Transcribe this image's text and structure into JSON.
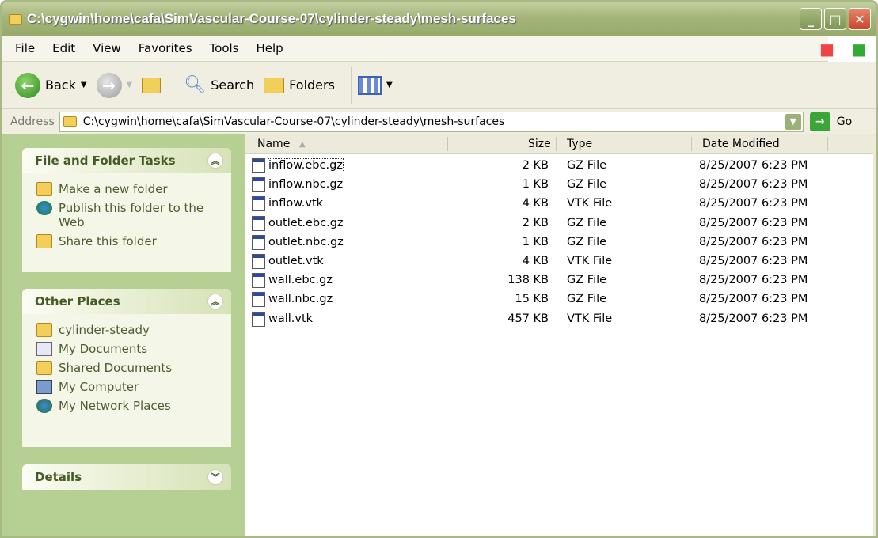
{
  "window": {
    "title": "C:\\cygwin\\home\\cafa\\SimVascular-Course-07\\cylinder-steady\\mesh-surfaces",
    "min": "_",
    "max": "□",
    "close": "✕"
  },
  "menu": [
    "File",
    "Edit",
    "View",
    "Favorites",
    "Tools",
    "Help"
  ],
  "toolbar": {
    "back": "Back",
    "search": "Search",
    "folders": "Folders"
  },
  "address": {
    "label": "Address",
    "value": "C:\\cygwin\\home\\cafa\\SimVascular-Course-07\\cylinder-steady\\mesh-surfaces",
    "go": "Go"
  },
  "sidebar": {
    "tasks": {
      "title": "File and Folder Tasks",
      "items": [
        "Make a new folder",
        "Publish this folder to the Web",
        "Share this folder"
      ]
    },
    "places": {
      "title": "Other Places",
      "items": [
        "cylinder-steady",
        "My Documents",
        "Shared Documents",
        "My Computer",
        "My Network Places"
      ]
    },
    "details": {
      "title": "Details"
    }
  },
  "columns": {
    "name": "Name",
    "size": "Size",
    "type": "Type",
    "date": "Date Modified"
  },
  "files": [
    {
      "name": "inflow.ebc.gz",
      "size": "2 KB",
      "type": "GZ File",
      "date": "8/25/2007 6:23 PM"
    },
    {
      "name": "inflow.nbc.gz",
      "size": "1 KB",
      "type": "GZ File",
      "date": "8/25/2007 6:23 PM"
    },
    {
      "name": "inflow.vtk",
      "size": "4 KB",
      "type": "VTK File",
      "date": "8/25/2007 6:23 PM"
    },
    {
      "name": "outlet.ebc.gz",
      "size": "2 KB",
      "type": "GZ File",
      "date": "8/25/2007 6:23 PM"
    },
    {
      "name": "outlet.nbc.gz",
      "size": "1 KB",
      "type": "GZ File",
      "date": "8/25/2007 6:23 PM"
    },
    {
      "name": "outlet.vtk",
      "size": "4 KB",
      "type": "VTK File",
      "date": "8/25/2007 6:23 PM"
    },
    {
      "name": "wall.ebc.gz",
      "size": "138 KB",
      "type": "GZ File",
      "date": "8/25/2007 6:23 PM"
    },
    {
      "name": "wall.nbc.gz",
      "size": "15 KB",
      "type": "GZ File",
      "date": "8/25/2007 6:23 PM"
    },
    {
      "name": "wall.vtk",
      "size": "457 KB",
      "type": "VTK File",
      "date": "8/25/2007 6:23 PM"
    }
  ]
}
